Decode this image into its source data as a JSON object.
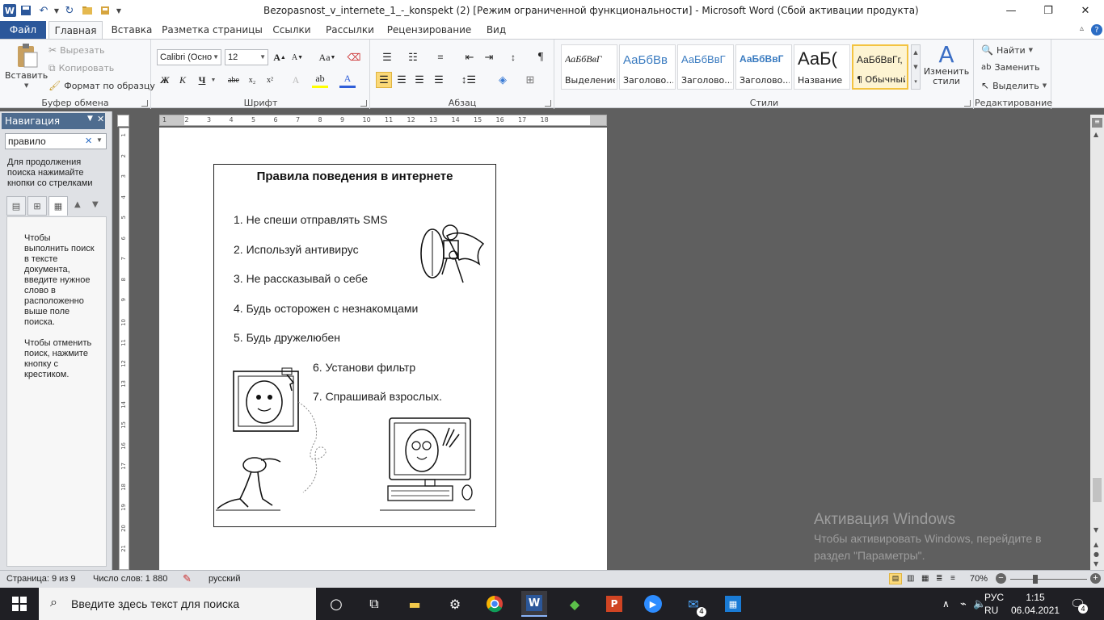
{
  "window": {
    "title": "Bezopasnost_v_internete_1_-_konspekt (2) [Режим ограниченной функциональности]  -  Microsoft Word (Сбой активации продукта)"
  },
  "tabs": [
    {
      "label": "Файл"
    },
    {
      "label": "Главная"
    },
    {
      "label": "Вставка"
    },
    {
      "label": "Разметка страницы"
    },
    {
      "label": "Ссылки"
    },
    {
      "label": "Рассылки"
    },
    {
      "label": "Рецензирование"
    },
    {
      "label": "Вид"
    }
  ],
  "ribbon": {
    "clipboard": {
      "label": "Буфер обмена",
      "paste": "Вставить",
      "cut": "Вырезать",
      "copy": "Копировать",
      "format_painter": "Формат по образцу"
    },
    "font": {
      "label": "Шрифт",
      "name": "Calibri (Осно",
      "size": "12"
    },
    "paragraph": {
      "label": "Абзац"
    },
    "styles": {
      "label": "Стили",
      "items": [
        {
          "sample": "АаБбВвГ",
          "name": "Выделение"
        },
        {
          "sample": "АаБбВв",
          "name": "Заголово..."
        },
        {
          "sample": "АаБбВвГ",
          "name": "Заголово..."
        },
        {
          "sample": "АаБбВвГ",
          "name": "Заголово..."
        },
        {
          "sample": "АаБ(",
          "name": "Название"
        },
        {
          "sample": "АаБбВвГг,",
          "name": "¶ Обычный"
        }
      ],
      "change_styles": "Изменить стили"
    },
    "editing": {
      "label": "Редактирование",
      "find": "Найти",
      "replace": "Заменить",
      "select": "Выделить"
    }
  },
  "navigation": {
    "header": "Навигация",
    "search_value": "правило",
    "hint": "Для продолжения поиска нажимайте кнопки со стрелками",
    "body_text_1": "Чтобы выполнить поиск в тексте документа, введите нужное слово в расположенно выше поле поиска.",
    "body_text_2": "Чтобы отменить поиск, нажмите кнопку с крестиком."
  },
  "document": {
    "title": "Правила поведения в интернете",
    "rules": [
      "1. Не спеши отправлять SMS",
      "2. Используй антивирус",
      "3. Не рассказывай о себе",
      "4. Будь осторожен с незнакомцами",
      "5. Будь дружелюбен",
      "6. Установи фильтр",
      "7. Спрашивай взрослых."
    ]
  },
  "activation": {
    "title": "Активация Windows",
    "line1": "Чтобы активировать Windows, перейдите в",
    "line2": "раздел \"Параметры\"."
  },
  "status": {
    "page": "Страница: 9 из 9",
    "words": "Число слов: 1 880",
    "language": "русский",
    "zoom": "70%"
  },
  "taskbar": {
    "search_placeholder": "Введите здесь текст для поиска",
    "lang_top": "РУС",
    "lang_bottom": "RU",
    "time": "1:15",
    "date": "06.04.2021",
    "mail_badge": "4",
    "notif_badge": "4"
  },
  "ruler_numbers": [
    "1",
    "2",
    "3",
    "4",
    "5",
    "6",
    "7",
    "8",
    "9",
    "10",
    "11",
    "12",
    "13",
    "14",
    "15",
    "16",
    "17",
    "18"
  ],
  "vruler_numbers": [
    "1",
    "2",
    "3",
    "4",
    "5",
    "6",
    "7",
    "8",
    "9",
    "10",
    "11",
    "12",
    "13",
    "14",
    "15",
    "16",
    "17",
    "18",
    "19",
    "20",
    "21"
  ]
}
